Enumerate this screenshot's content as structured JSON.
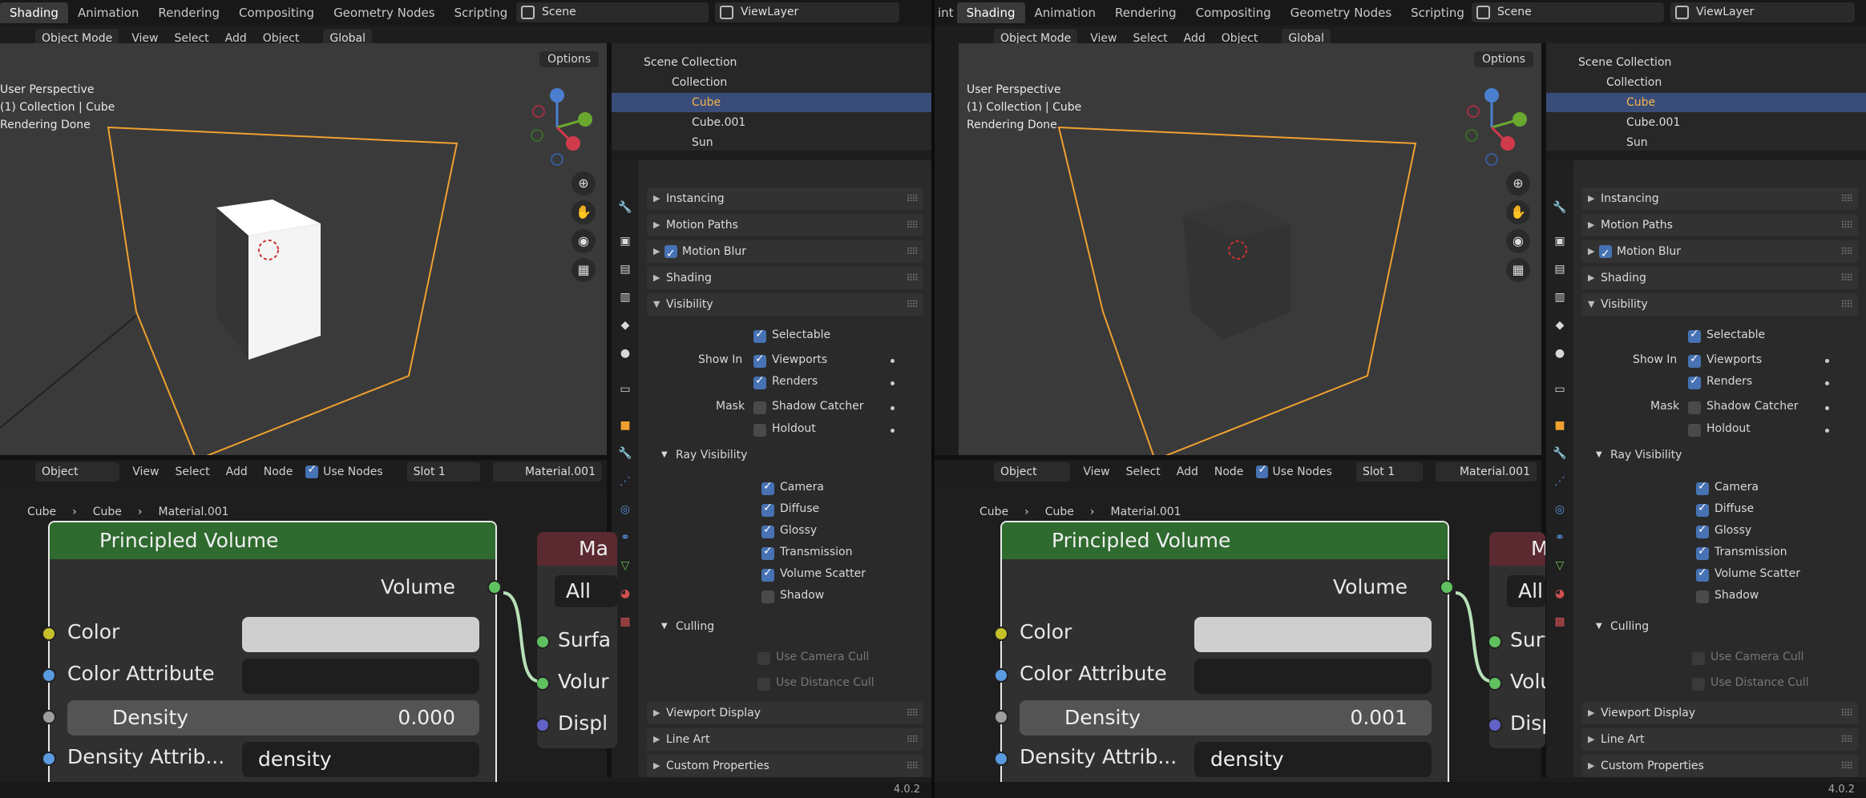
{
  "workspaces": [
    "Shading",
    "Animation",
    "Rendering",
    "Compositing",
    "Geometry Nodes",
    "Scripting"
  ],
  "workspaces_right": [
    "int",
    "Shading",
    "Animation",
    "Rendering",
    "Compositing",
    "Geometry Nodes",
    "Scripting"
  ],
  "scene": "Scene",
  "viewlayer": "ViewLayer",
  "viewport": {
    "mode": "Object Mode",
    "menus": [
      "View",
      "Select",
      "Add",
      "Object"
    ],
    "orientation": "Global",
    "options": "Options",
    "info": [
      "User Perspective",
      "(1) Collection | Cube",
      "Rendering Done"
    ]
  },
  "outliner": {
    "root": "Scene Collection",
    "collection": "Collection",
    "items": [
      "Cube",
      "Cube.001",
      "Sun"
    ]
  },
  "props": {
    "sections_top": [
      "Instancing",
      "Motion Paths",
      "Motion Blur",
      "Shading",
      "Visibility"
    ],
    "selectable": "Selectable",
    "show_in": "Show In",
    "viewports": "Viewports",
    "renders": "Renders",
    "mask": "Mask",
    "shadow_catcher": "Shadow Catcher",
    "holdout": "Holdout",
    "ray_visibility": "Ray Visibility",
    "rays": [
      "Camera",
      "Diffuse",
      "Glossy",
      "Transmission",
      "Volume Scatter",
      "Shadow"
    ],
    "culling": "Culling",
    "camera_cull": "Use Camera Cull",
    "distance_cull": "Use Distance Cull",
    "sections_bottom": [
      "Viewport Display",
      "Line Art",
      "Custom Properties"
    ]
  },
  "nodeeditor": {
    "type": "Object",
    "menus": [
      "View",
      "Select",
      "Add",
      "Node"
    ],
    "use_nodes": "Use Nodes",
    "slot": "Slot 1",
    "material": "Material.001",
    "breadcrumb": [
      "Cube",
      "Cube",
      "Material.001"
    ]
  },
  "node": {
    "title": "Principled Volume",
    "output": "Volume",
    "inputs": [
      "Color",
      "Color Attribute",
      "Density",
      "Density Attrib..."
    ],
    "density_attr": "density",
    "density_left": "0.000",
    "density_right": "0.001"
  },
  "node2": {
    "head": "Ma",
    "btn": "All",
    "sockets": [
      "Surfa",
      "Volur",
      "Displ"
    ]
  },
  "version": "4.0.2"
}
